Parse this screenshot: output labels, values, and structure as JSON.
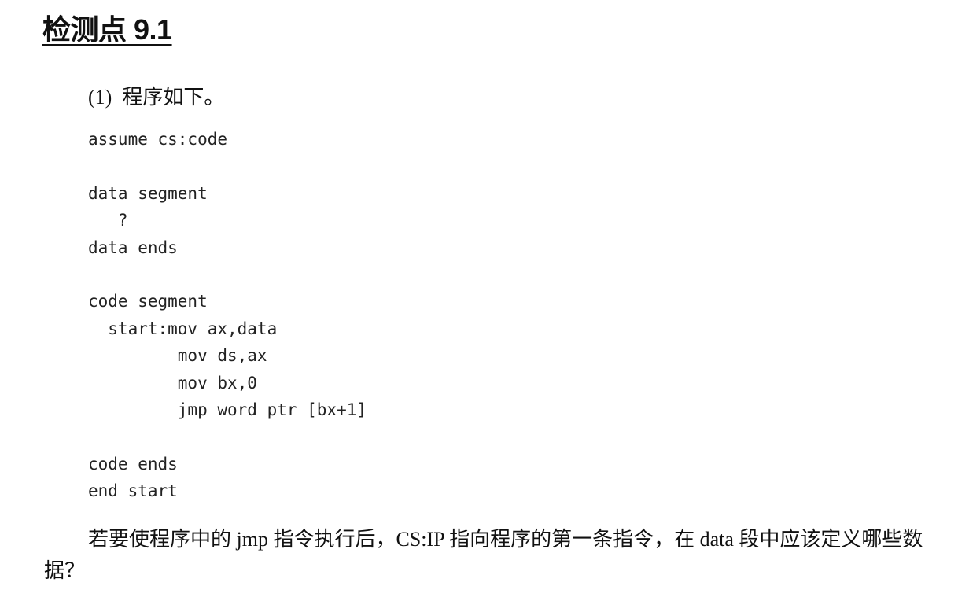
{
  "title": "检测点 9.1",
  "intro": "(1)  程序如下。",
  "code_lines": [
    "assume cs:code",
    "",
    "data segment",
    "   ?",
    "data ends",
    "",
    "code segment",
    "  start:mov ax,data",
    "         mov ds,ax",
    "         mov bx,0",
    "         jmp word ptr [bx+1]",
    "",
    "code ends",
    "end start"
  ],
  "question": "若要使程序中的 jmp 指令执行后，CS:IP 指向程序的第一条指令，在 data 段中应该定义哪些数据？"
}
